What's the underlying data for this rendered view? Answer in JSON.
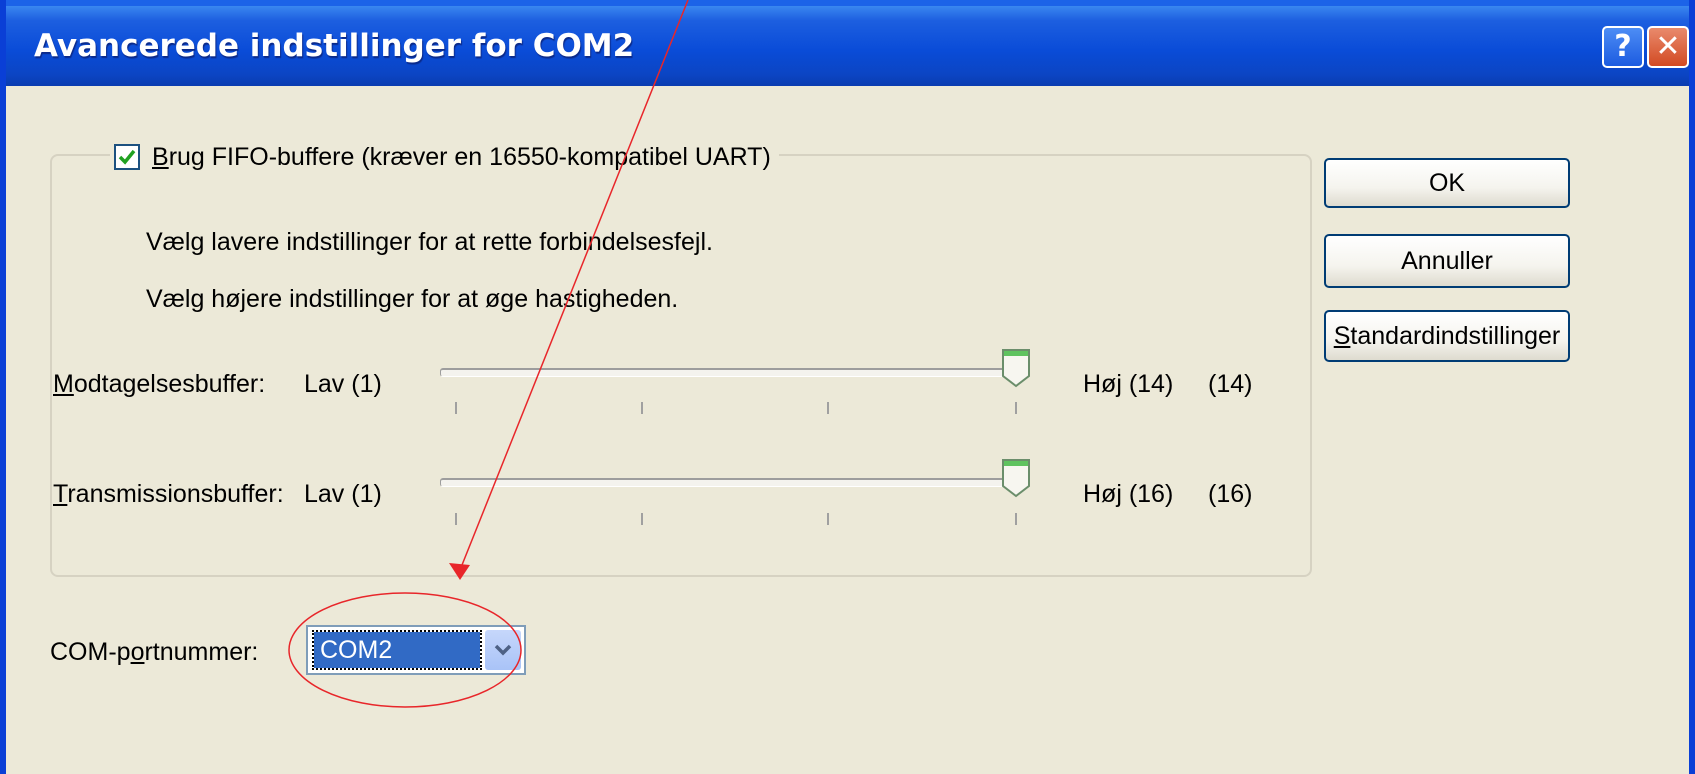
{
  "window": {
    "title": "Avancerede indstillinger for COM2",
    "help_label": "?",
    "close_label": "✕"
  },
  "fifo": {
    "checked": true,
    "label_key": "B",
    "label_rest": "rug FIFO-buffere (kræver en 16550-kompatibel UART)"
  },
  "info": {
    "line1": "Vælg lavere indstillinger for at rette forbindelsesfejl.",
    "line2": "Vælg højere indstillinger for at øge hastigheden."
  },
  "receive": {
    "label_key": "M",
    "label_rest": "odtagelsesbuffer:",
    "low": "Lav (1)",
    "high": "Høj (14)",
    "value_text": "(14)",
    "value": 14,
    "min": 1,
    "max": 14
  },
  "transmit": {
    "label_key": "T",
    "label_rest": "ransmissionsbuffer:",
    "low": "Lav (1)",
    "high": "Høj (16)",
    "value_text": "(16)",
    "value": 16,
    "min": 1,
    "max": 16
  },
  "buttons": {
    "ok": "OK",
    "cancel": "Annuller",
    "defaults_key": "S",
    "defaults_rest": "tandardindstillinger"
  },
  "port": {
    "label_pre": "COM-p",
    "label_key": "o",
    "label_post": "rtnummer:",
    "selected": "COM2"
  },
  "colors": {
    "titlebar": "#0a4cd8",
    "dialog_bg": "#ece9d8",
    "selection": "#316ac5",
    "annotation": "#e8262a"
  },
  "icons": {
    "help": "help-icon",
    "close": "close-icon",
    "check": "checkmark-icon",
    "dropdown": "chevron-down-icon"
  }
}
